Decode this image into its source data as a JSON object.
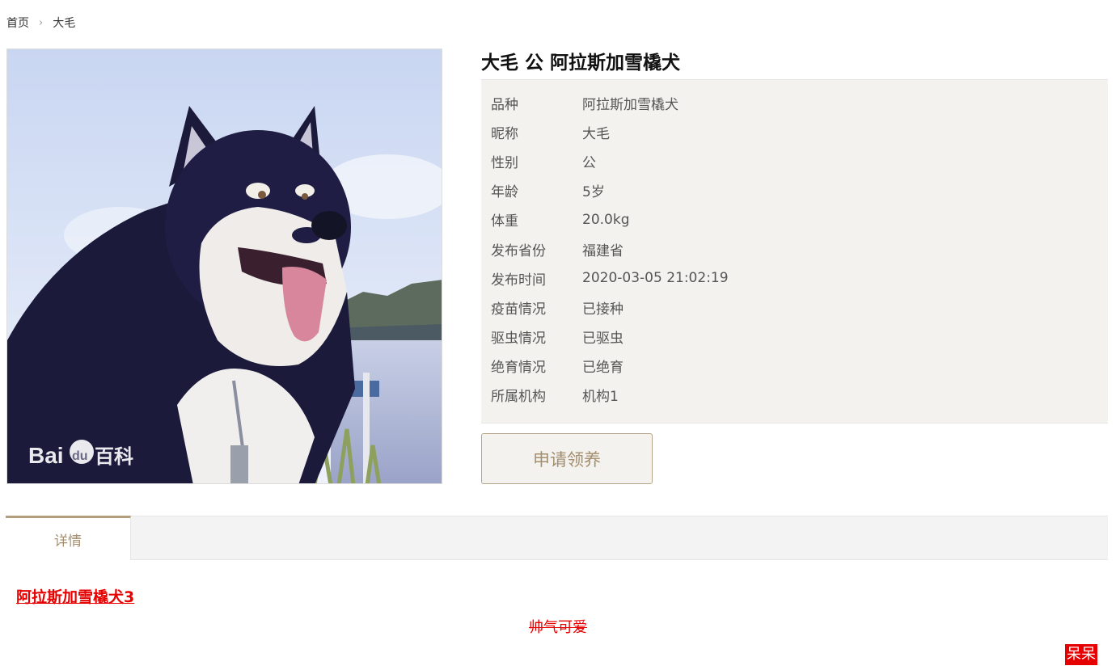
{
  "breadcrumb": {
    "home": "首页",
    "current": "大毛"
  },
  "photo": {
    "watermark_brand": "Bai",
    "watermark_du": "du",
    "watermark_text": "百科"
  },
  "pet": {
    "title": "大毛 公 阿拉斯加雪橇犬",
    "fields": [
      {
        "label": "品种",
        "value": "阿拉斯加雪橇犬"
      },
      {
        "label": "昵称",
        "value": "大毛"
      },
      {
        "label": "性别",
        "value": "公"
      },
      {
        "label": "年龄",
        "value": "5岁"
      },
      {
        "label": "体重",
        "value": "20.0kg"
      },
      {
        "label": "发布省份",
        "value": "福建省"
      },
      {
        "label": "发布时间",
        "value": "2020-03-05 21:02:19"
      },
      {
        "label": "疫苗情况",
        "value": "已接种"
      },
      {
        "label": "驱虫情况",
        "value": "已驱虫"
      },
      {
        "label": "绝育情况",
        "value": "已绝育"
      },
      {
        "label": "所属机构",
        "value": "机构1"
      }
    ]
  },
  "actions": {
    "adopt_label": "申请领养"
  },
  "tabs": {
    "detail_label": "详情"
  },
  "detail": {
    "heading": "阿拉斯加雪橇犬3",
    "strike_text": "帅气可爱",
    "badge_text": "呆呆"
  },
  "colors": {
    "accent": "#b39d7c",
    "accent_text": "#a48e6f",
    "panel_bg": "#f3f2ef",
    "detail_red": "#e60000"
  }
}
